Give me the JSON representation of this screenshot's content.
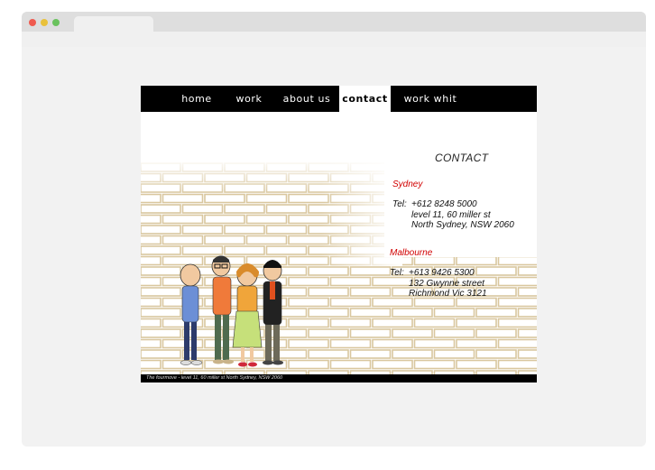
{
  "browser": {
    "colors": {
      "close": "#ef5a4f",
      "minimize": "#e9c13b",
      "maximize": "#69c25d"
    }
  },
  "nav": [
    {
      "label": "home",
      "active": false
    },
    {
      "label": "work",
      "active": false
    },
    {
      "label": "about us",
      "active": false
    },
    {
      "label": "contact",
      "active": true
    },
    {
      "label": "work whit us",
      "active": false
    }
  ],
  "contact": {
    "title": "CONTACT",
    "sydney": {
      "city": "Sydney",
      "tel_label": "Tel:",
      "tel": "+612 8248 5000",
      "address1": "level 11, 60 miller st",
      "address2": "North Sydney, NSW 2060"
    },
    "melbourne": {
      "city": "Malbourne",
      "tel_label": "Tel:",
      "tel": "+613 9426 5300",
      "address1": "132 Gwynne street",
      "address2": "Richmond Vic 3121"
    }
  },
  "footer": {
    "text": "The fourmove - level 11, 60 miller st North Sydney, NSW 2060"
  },
  "colors": {
    "city": "#d10000",
    "nav_bg": "#000000"
  }
}
